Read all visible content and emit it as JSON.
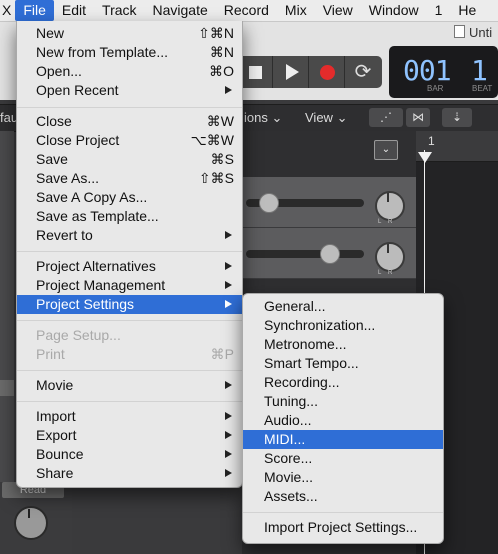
{
  "menubar": {
    "items": [
      "X",
      "File",
      "Edit",
      "Track",
      "Navigate",
      "Record",
      "Mix",
      "View",
      "Window",
      "1",
      "He"
    ]
  },
  "window": {
    "title": "Unti"
  },
  "lcd": {
    "bar": "001",
    "beat": "1",
    "beat_tail": "",
    "bar_label": "BAR",
    "beat_label": "BEAT"
  },
  "toolbar": {
    "functions": "ions",
    "view": "View",
    "left_fragment": "fau"
  },
  "ruler": {
    "start": "1"
  },
  "track": {
    "automation_mode": "Read"
  },
  "file_menu": {
    "items": [
      {
        "label": "New",
        "shortcut": "⇧⌘N"
      },
      {
        "label": "New from Template...",
        "shortcut": "⌘N"
      },
      {
        "label": "Open...",
        "shortcut": "⌘O"
      },
      {
        "label": "Open Recent"
      },
      {
        "label": "Close",
        "shortcut": "⌘W"
      },
      {
        "label": "Close Project",
        "shortcut": "⌥⌘W"
      },
      {
        "label": "Save",
        "shortcut": "⌘S"
      },
      {
        "label": "Save As...",
        "shortcut": "⇧⌘S"
      },
      {
        "label": "Save A Copy As..."
      },
      {
        "label": "Save as Template..."
      },
      {
        "label": "Revert to"
      },
      {
        "label": "Project Alternatives"
      },
      {
        "label": "Project Management"
      },
      {
        "label": "Project Settings"
      },
      {
        "label": "Page Setup..."
      },
      {
        "label": "Print",
        "shortcut": "⌘P"
      },
      {
        "label": "Movie"
      },
      {
        "label": "Import"
      },
      {
        "label": "Export"
      },
      {
        "label": "Bounce"
      },
      {
        "label": "Share"
      }
    ]
  },
  "project_settings_menu": {
    "items": [
      "General...",
      "Synchronization...",
      "Metronome...",
      "Smart Tempo...",
      "Recording...",
      "Tuning...",
      "Audio...",
      "MIDI...",
      "Score...",
      "Movie...",
      "Assets...",
      "Import Project Settings..."
    ],
    "highlighted": "MIDI..."
  },
  "colors": {
    "highlight": "#2f6ed6",
    "menu_bg": "#e8e8e8",
    "record": "#e42b2b",
    "lcd_text": "#8fc3ff"
  }
}
